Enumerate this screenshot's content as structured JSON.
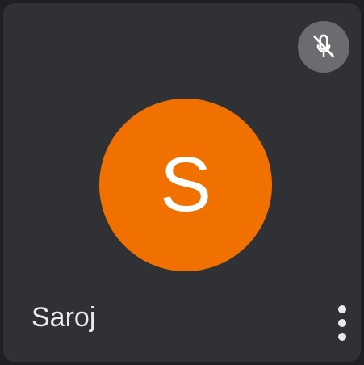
{
  "participant": {
    "name": "Saroj",
    "initial": "S",
    "avatar_color": "#f07100",
    "mic_status_icon": "mic-off-icon",
    "menu_icon": "more-vert-icon"
  },
  "colors": {
    "tile_background": "#303134",
    "badge_background": "#6b6c70",
    "text": "#e8eaed"
  }
}
